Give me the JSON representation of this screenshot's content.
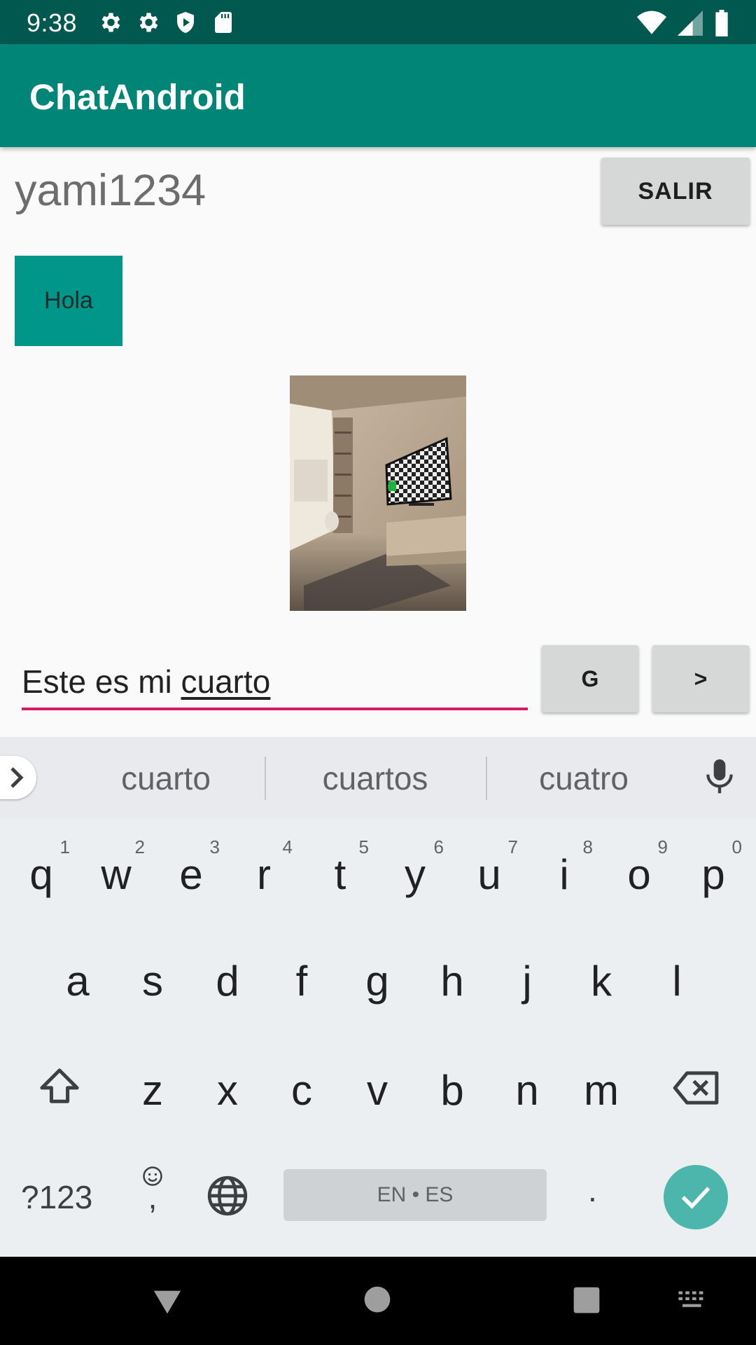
{
  "status_bar": {
    "time": "9:38"
  },
  "app_bar": {
    "title": "ChatAndroid"
  },
  "chat": {
    "username": "yami1234",
    "exit_label": "SALIR",
    "messages": [
      {
        "text": "Hola"
      }
    ],
    "image_description": "photo-message"
  },
  "composer": {
    "text_before": "Este es mi ",
    "text_underlined": "cuarto",
    "g_label": "G",
    "send_label": ">"
  },
  "keyboard": {
    "suggestions": [
      "cuarto",
      "cuartos",
      "cuatro"
    ],
    "row1": [
      {
        "key": "q",
        "hint": "1"
      },
      {
        "key": "w",
        "hint": "2"
      },
      {
        "key": "e",
        "hint": "3"
      },
      {
        "key": "r",
        "hint": "4"
      },
      {
        "key": "t",
        "hint": "5"
      },
      {
        "key": "y",
        "hint": "6"
      },
      {
        "key": "u",
        "hint": "7"
      },
      {
        "key": "i",
        "hint": "8"
      },
      {
        "key": "o",
        "hint": "9"
      },
      {
        "key": "p",
        "hint": "0"
      }
    ],
    "row2": [
      "a",
      "s",
      "d",
      "f",
      "g",
      "h",
      "j",
      "k",
      "l"
    ],
    "row3": [
      "z",
      "x",
      "c",
      "v",
      "b",
      "n",
      "m"
    ],
    "symbols_label": "?123",
    "comma_label": ",",
    "space_label": "EN • ES",
    "period_label": "."
  },
  "colors": {
    "status_bar": "#00584f",
    "app_bar": "#008577",
    "bubble": "#00968a",
    "input_underline": "#d81b60",
    "enter_key": "#4db6ac"
  }
}
